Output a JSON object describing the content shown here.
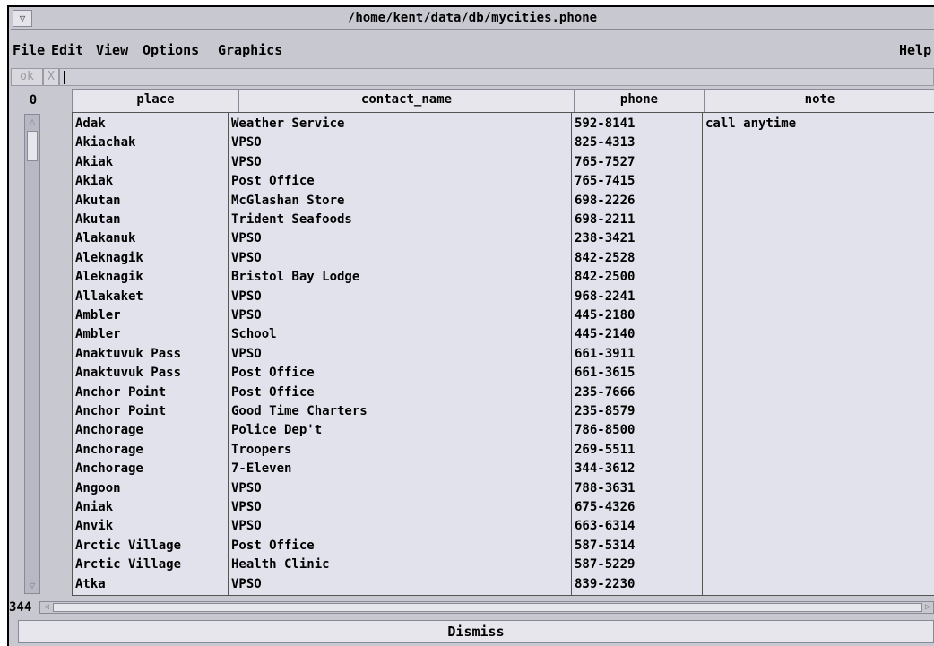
{
  "window": {
    "title": "/home/kent/data/db/mycities.phone",
    "menu_button_glyph": "▽"
  },
  "menus": [
    {
      "underline": "F",
      "rest": "ile"
    },
    {
      "underline": "E",
      "rest": "dit"
    },
    {
      "underline": "V",
      "rest": "iew"
    },
    {
      "underline": "O",
      "rest": "ptions"
    },
    {
      "underline": "G",
      "rest": "raphics"
    }
  ],
  "help_menu": {
    "underline": "H",
    "rest": "elp"
  },
  "command": {
    "ok_label": "ok",
    "cancel_label": "X",
    "value": ""
  },
  "table": {
    "top_row_index": "0",
    "row_count": "344",
    "columns": [
      "place",
      "contact_name",
      "phone",
      "note"
    ],
    "rows": [
      [
        "Adak",
        "Weather Service",
        "592-8141",
        "call anytime"
      ],
      [
        "Akiachak",
        "VPSO",
        "825-4313",
        ""
      ],
      [
        "Akiak",
        "VPSO",
        "765-7527",
        ""
      ],
      [
        "Akiak",
        "Post Office",
        "765-7415",
        ""
      ],
      [
        "Akutan",
        "McGlashan Store",
        "698-2226",
        ""
      ],
      [
        "Akutan",
        "Trident Seafoods",
        "698-2211",
        ""
      ],
      [
        "Alakanuk",
        "VPSO",
        "238-3421",
        ""
      ],
      [
        "Aleknagik",
        "VPSO",
        "842-2528",
        ""
      ],
      [
        "Aleknagik",
        "Bristol Bay Lodge",
        "842-2500",
        ""
      ],
      [
        "Allakaket",
        "VPSO",
        "968-2241",
        ""
      ],
      [
        "Ambler",
        "VPSO",
        "445-2180",
        ""
      ],
      [
        "Ambler",
        "School",
        "445-2140",
        ""
      ],
      [
        "Anaktuvuk Pass",
        "VPSO",
        "661-3911",
        ""
      ],
      [
        "Anaktuvuk Pass",
        "Post Office",
        "661-3615",
        ""
      ],
      [
        "Anchor Point",
        "Post Office",
        "235-7666",
        ""
      ],
      [
        "Anchor Point",
        "Good Time Charters",
        "235-8579",
        ""
      ],
      [
        "Anchorage",
        "Police Dep't",
        "786-8500",
        ""
      ],
      [
        "Anchorage",
        "Troopers",
        "269-5511",
        ""
      ],
      [
        "Anchorage",
        "7-Eleven",
        "344-3612",
        ""
      ],
      [
        "Angoon",
        "VPSO",
        "788-3631",
        ""
      ],
      [
        "Aniak",
        "VPSO",
        "675-4326",
        ""
      ],
      [
        "Anvik",
        "VPSO",
        "663-6314",
        ""
      ],
      [
        "Arctic Village",
        "Post Office",
        "587-5314",
        ""
      ],
      [
        "Arctic Village",
        "Health Clinic",
        "587-5229",
        ""
      ],
      [
        "Atka",
        "VPSO",
        "839-2230",
        ""
      ]
    ]
  },
  "scrollbars": {
    "up_glyph": "△",
    "down_glyph": "▽",
    "left_glyph": "◁",
    "right_glyph": "▷"
  },
  "dismiss_label": "Dismiss",
  "colors": {
    "window_bg": "#c8c8d0",
    "cell_bg": "#e2e2ec",
    "header_bg": "#e6e6ec"
  }
}
